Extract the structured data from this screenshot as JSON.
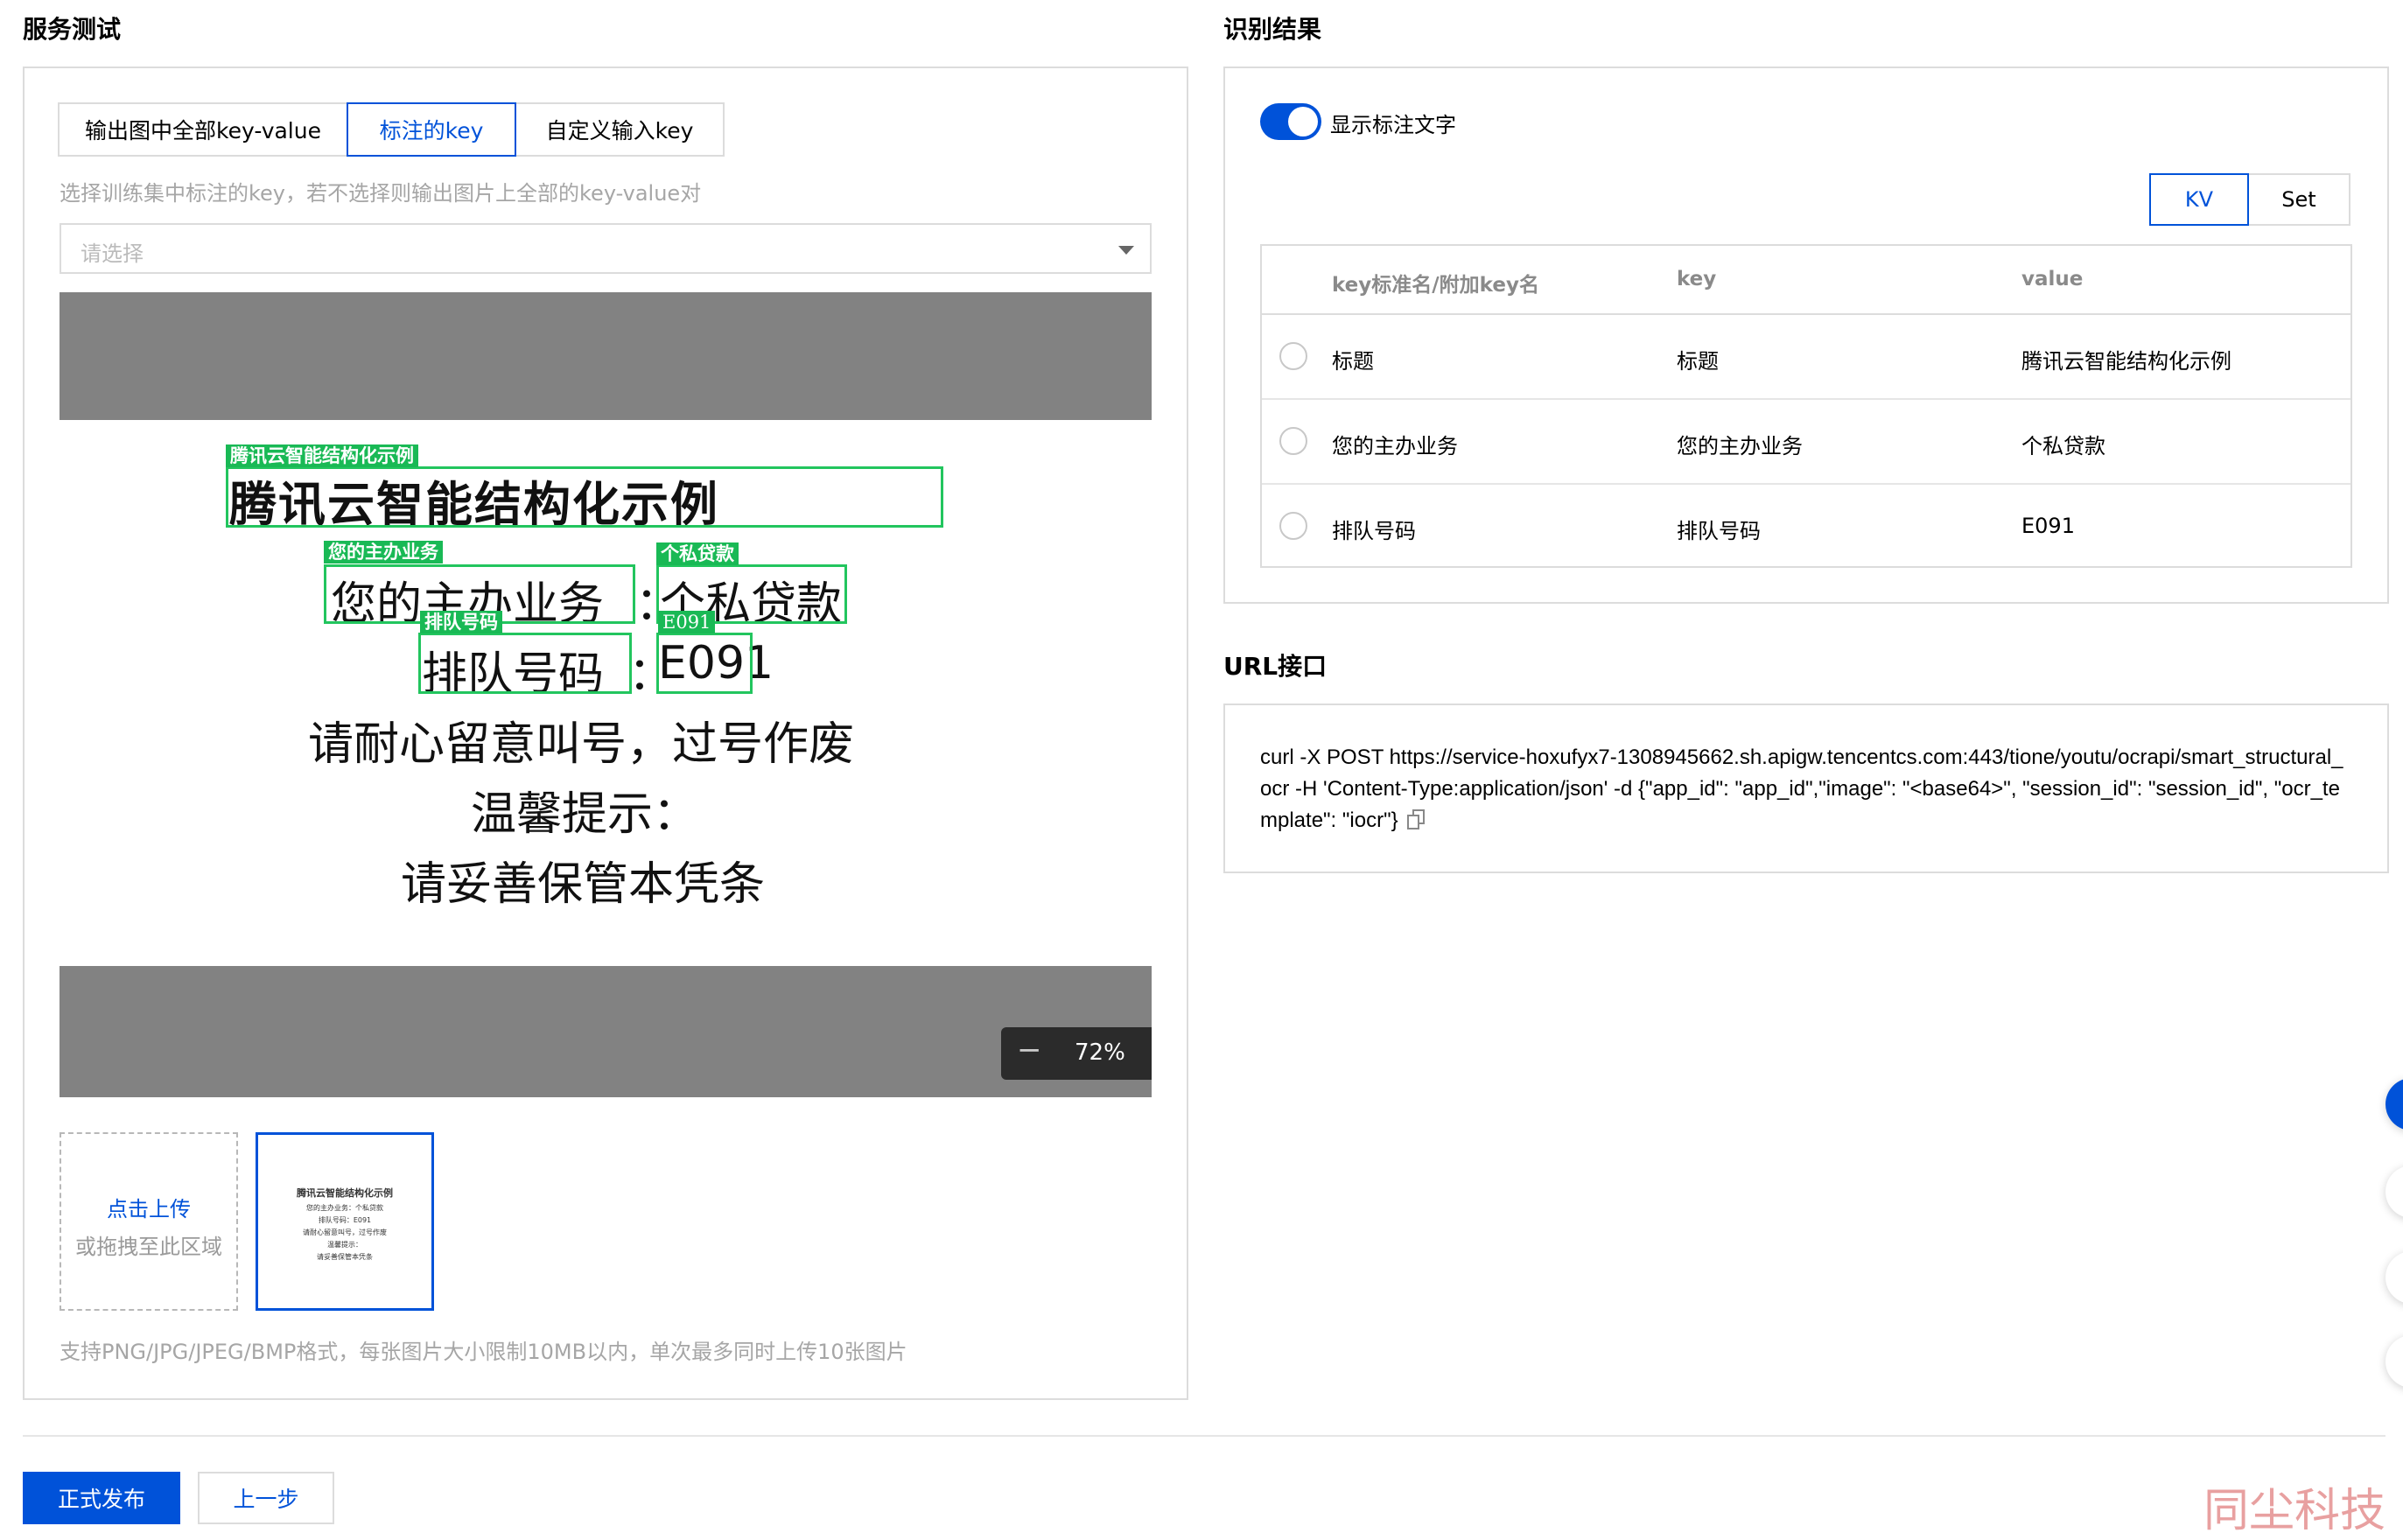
{
  "left": {
    "title": "服务测试",
    "tabs": [
      "输出图中全部key-value",
      "标注的key",
      "自定义输入key"
    ],
    "hint": "选择训练集中标注的key，若不选择则输出图片上全部的key-value对",
    "select_placeholder": "请选择",
    "document": {
      "title": "腾讯云智能结构化示例",
      "line1_key": "您的主办业务",
      "line1_val": "个私贷款",
      "line2_key": "排队号码",
      "line2_val": "E091",
      "line3": "请耐心留意叫号，过号作废",
      "line4": "温馨提示：",
      "line5": "请妥善保管本凭条",
      "tags": [
        "腾讯云智能结构化示例",
        "您的主办业务",
        "个私贷款",
        "排队号码",
        "E091"
      ]
    },
    "zoom": {
      "minus": "−",
      "value": "72%",
      "plus": "+"
    },
    "upload": {
      "line1": "点击上传",
      "line2": "或拖拽至此区域"
    },
    "thumbnail_lines": [
      "腾讯云智能结构化示例",
      "您的主办业务：个私贷款",
      "排队号码：E091",
      "请耐心留意叫号，过号作废",
      "温馨提示：",
      "请妥善保管本凭条"
    ],
    "footnote": "支持PNG/JPG/JPEG/BMP格式，每张图片大小限制10MB以内，单次最多同时上传10张图片"
  },
  "right": {
    "title": "识别结果",
    "toggle_label": "显示标注文字",
    "toggle_on": true,
    "segments": [
      "KV",
      "Set"
    ],
    "table": {
      "headers": [
        "key标准名/附加key名",
        "key",
        "value"
      ],
      "rows": [
        [
          "标题",
          "标题",
          "腾讯云智能结构化示例"
        ],
        [
          "您的主办业务",
          "您的主办业务",
          "个私贷款"
        ],
        [
          "排队号码",
          "排队号码",
          "E091"
        ]
      ]
    },
    "url_title": "URL接口",
    "url_text": "curl -X POST https://service-hoxufyx7-1308945662.sh.apigw.tencentcs.com:443/tione/youtu/ocrapi/smart_structural_ocr -H 'Content-Type:application/json' -d {\"app_id\": \"app_id\",\"image\": \"<base64>\", \"session_id\": \"session_id\", \"ocr_template\": \"iocr\"}"
  },
  "footer": {
    "primary": "正式发布",
    "secondary": "上一步",
    "watermark": "同尘科技"
  },
  "colors": {
    "accent": "#0052d9",
    "annotation": "#19b955",
    "gray_bg": "#828282"
  }
}
